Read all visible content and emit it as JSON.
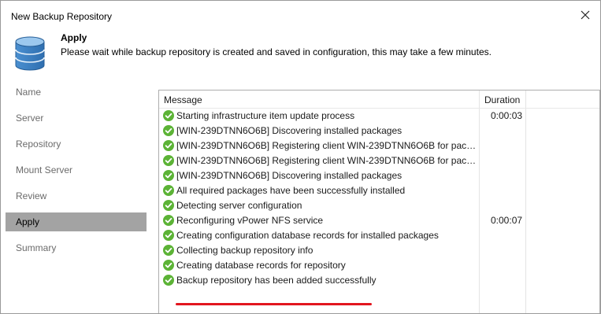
{
  "window": {
    "title": "New Backup Repository"
  },
  "header": {
    "title": "Apply",
    "description": "Please wait while backup repository is created and saved in configuration, this may take a few minutes."
  },
  "sidebar": {
    "items": [
      {
        "label": "Name",
        "active": false
      },
      {
        "label": "Server",
        "active": false
      },
      {
        "label": "Repository",
        "active": false
      },
      {
        "label": "Mount Server",
        "active": false
      },
      {
        "label": "Review",
        "active": false
      },
      {
        "label": "Apply",
        "active": true
      },
      {
        "label": "Summary",
        "active": false
      }
    ]
  },
  "log": {
    "columns": {
      "message": "Message",
      "duration": "Duration"
    },
    "status_color": "#5cb336",
    "rows": [
      {
        "message": "Starting infrastructure item update process",
        "duration": "0:00:03"
      },
      {
        "message": "[WIN-239DTNN6O6B] Discovering installed packages",
        "duration": ""
      },
      {
        "message": "[WIN-239DTNN6O6B] Registering client WIN-239DTNN6O6B for packa...",
        "duration": ""
      },
      {
        "message": "[WIN-239DTNN6O6B] Registering client WIN-239DTNN6O6B for packa...",
        "duration": ""
      },
      {
        "message": "[WIN-239DTNN6O6B] Discovering installed packages",
        "duration": ""
      },
      {
        "message": "All required packages have been successfully installed",
        "duration": ""
      },
      {
        "message": "Detecting server configuration",
        "duration": ""
      },
      {
        "message": "Reconfiguring vPower NFS service",
        "duration": "0:00:07"
      },
      {
        "message": "Creating configuration database records for installed packages",
        "duration": ""
      },
      {
        "message": "Collecting backup repository info",
        "duration": ""
      },
      {
        "message": "Creating database records for repository",
        "duration": ""
      },
      {
        "message": "Backup repository has been added successfully",
        "duration": ""
      }
    ]
  },
  "annotation_color": "#e2161f"
}
